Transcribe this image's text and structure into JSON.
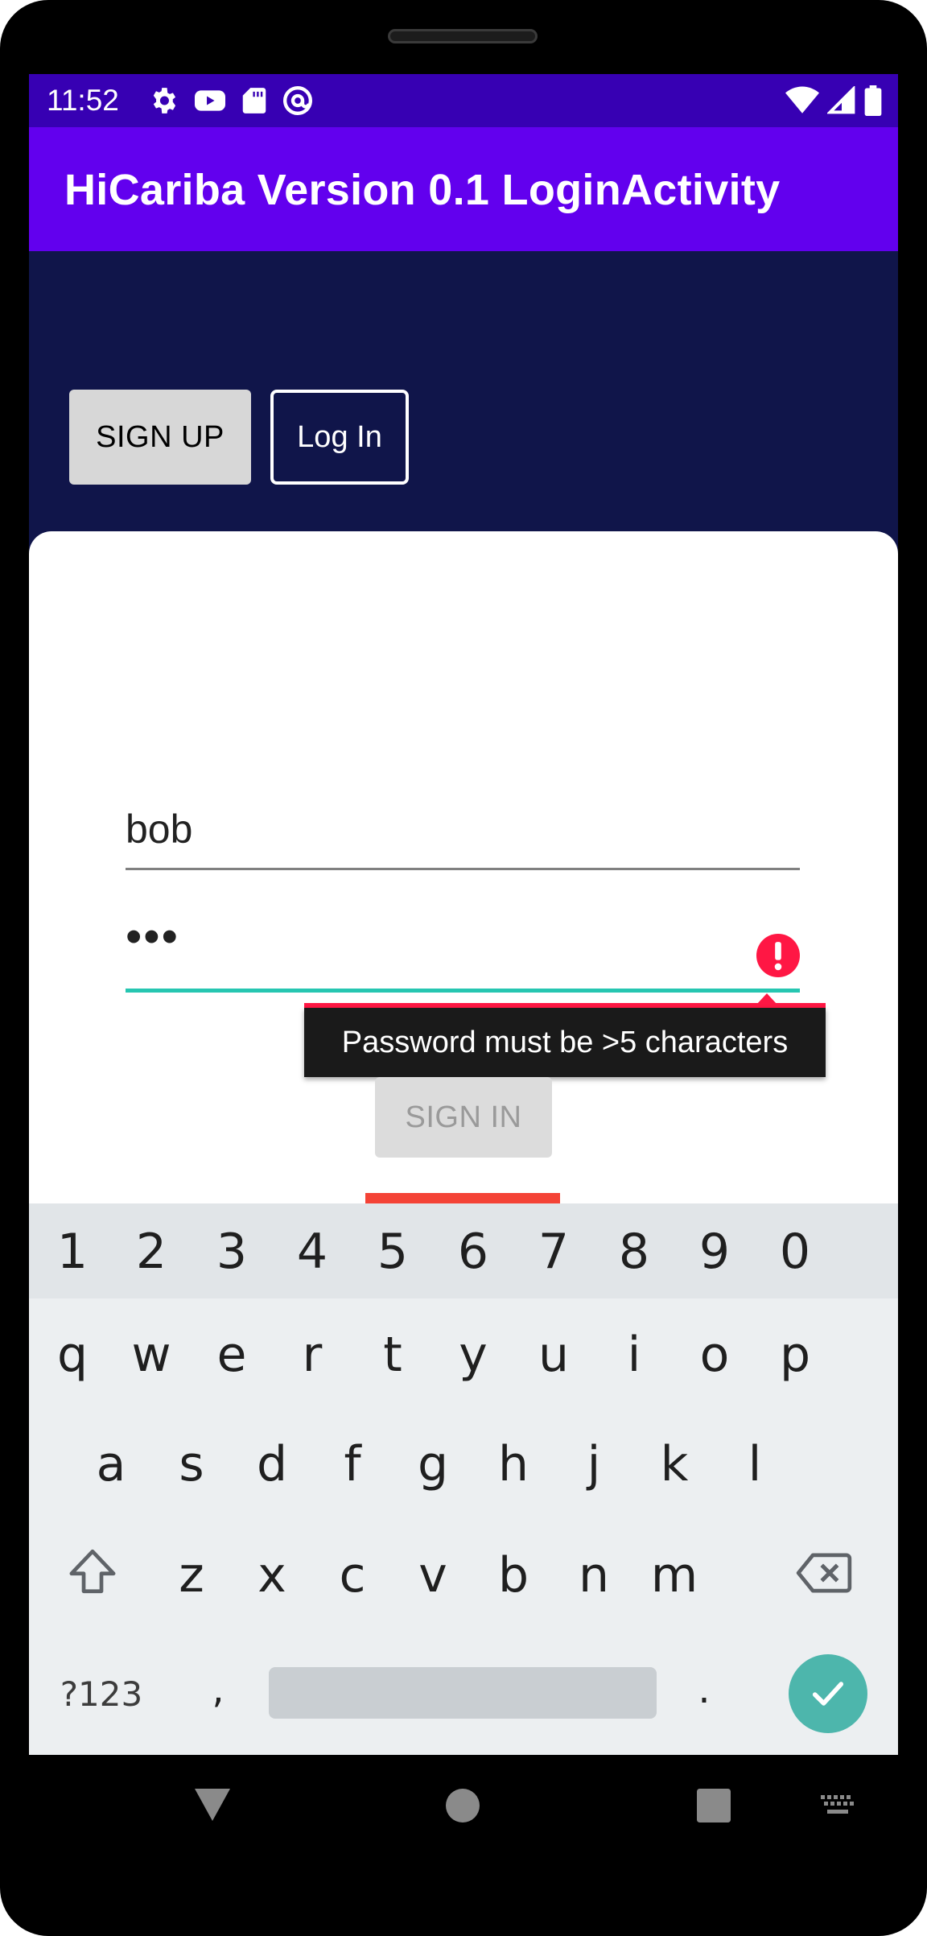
{
  "status_bar": {
    "time": "11:52",
    "left_icons": [
      "settings-icon",
      "youtube-icon",
      "sd-card-icon",
      "at-sign-icon"
    ],
    "right_icons": [
      "wifi-icon",
      "signal-icon",
      "battery-icon"
    ]
  },
  "app_bar": {
    "title": "HiCariba Version 0.1 LoginActivity"
  },
  "header": {
    "signup_label": "SIGN UP",
    "login_label": "Log In"
  },
  "form": {
    "username_value": "bob",
    "password_value": "•••",
    "password_error": "Password must be >5 characters",
    "signin_label": "SIGN IN"
  },
  "keyboard": {
    "number_row": [
      "1",
      "2",
      "3",
      "4",
      "5",
      "6",
      "7",
      "8",
      "9",
      "0"
    ],
    "row1": [
      "q",
      "w",
      "e",
      "r",
      "t",
      "y",
      "u",
      "i",
      "o",
      "p"
    ],
    "row2": [
      "a",
      "s",
      "d",
      "f",
      "g",
      "h",
      "j",
      "k",
      "l"
    ],
    "row3": [
      "z",
      "x",
      "c",
      "v",
      "b",
      "n",
      "m"
    ],
    "symbols_label": "?123",
    "comma_label": ",",
    "period_label": "."
  },
  "colors": {
    "status_bar": "#3700b3",
    "app_bar": "#6200ee",
    "header_bg": "#10154a",
    "accent": "#26c6b1",
    "error": "#ff1744",
    "enter_key": "#4db6ac"
  }
}
